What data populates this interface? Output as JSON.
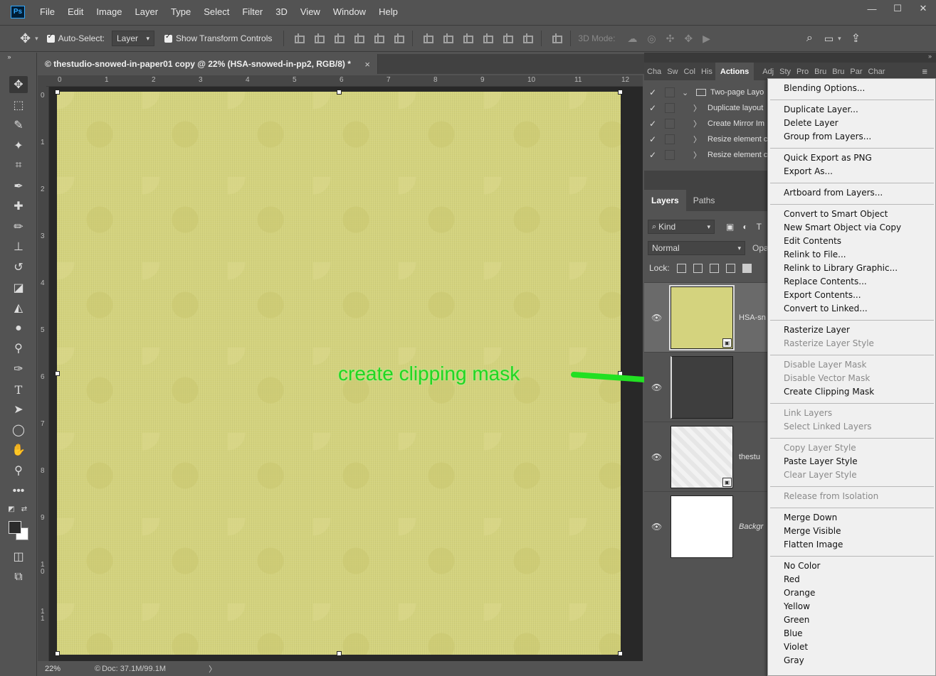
{
  "app": {
    "logo": "Ps"
  },
  "menubar": [
    "File",
    "Edit",
    "Image",
    "Layer",
    "Type",
    "Select",
    "Filter",
    "3D",
    "View",
    "Window",
    "Help"
  ],
  "window_controls": {
    "minimize": "—",
    "maximize": "☐",
    "close": "✕"
  },
  "options": {
    "auto_select_label": "Auto-Select:",
    "auto_select_checked": true,
    "auto_select_target": "Layer",
    "show_transform_label": "Show Transform Controls",
    "show_transform_checked": true,
    "mode_3d_label": "3D Mode:"
  },
  "document": {
    "tab_title": "© thestudio-snowed-in-paper01 copy @ 22% (HSA-snowed-in-pp2, RGB/8) *",
    "close": "×",
    "zoom": "22%",
    "doc_size": "Doc: 37.1M/99.1M",
    "status_chevron": "〉"
  },
  "rulers": {
    "h_ticks": [
      "0",
      "1",
      "2",
      "3",
      "4",
      "5",
      "6",
      "7",
      "8",
      "9",
      "10",
      "11",
      "12"
    ],
    "v_ticks": [
      "0",
      "1",
      "2",
      "3",
      "4",
      "5",
      "6",
      "7",
      "8",
      "9",
      "1\n0",
      "1\n1"
    ]
  },
  "canvas": {
    "fill_color": "#d4d37e"
  },
  "annotation": {
    "text": "create clipping mask",
    "color": "#22d622"
  },
  "top_panel_tabs": [
    "Cha",
    "Sw",
    "Col",
    "His",
    "Actions",
    "Adj",
    "Sty",
    "Pro",
    "Bru",
    "Bru",
    "Par",
    "Char"
  ],
  "top_panel_active": "Actions",
  "actions": [
    {
      "label": "Two-page Layo",
      "checked": true,
      "expanded": true,
      "folder": true
    },
    {
      "label": "Duplicate layout",
      "checked": true
    },
    {
      "label": "Create Mirror Im",
      "checked": true
    },
    {
      "label": "Resize element c",
      "checked": true
    },
    {
      "label": "Resize element c",
      "checked": true
    }
  ],
  "layers_tabs": [
    "Layers",
    "Paths"
  ],
  "layers_filter": {
    "kind_label": "Kind",
    "blend_mode": "Normal",
    "opacity_label": "Opa",
    "lock_label": "Lock:"
  },
  "layers": [
    {
      "name": "HSA-sn",
      "selected": true,
      "thumb": "yellow",
      "smart": true
    },
    {
      "name": "",
      "selected": false,
      "thumb": "dark",
      "smart": false
    },
    {
      "name": "thestu",
      "selected": false,
      "thumb": "white-pattern",
      "smart": true
    },
    {
      "name": "Backgr",
      "selected": false,
      "thumb": "white",
      "smart": false
    }
  ],
  "context_menu": [
    {
      "label": "Blending Options...",
      "disabled": false
    },
    {
      "sep": true
    },
    {
      "label": "Duplicate Layer...",
      "disabled": false
    },
    {
      "label": "Delete Layer",
      "disabled": false
    },
    {
      "label": "Group from Layers...",
      "disabled": false
    },
    {
      "sep": true
    },
    {
      "label": "Quick Export as PNG",
      "disabled": false
    },
    {
      "label": "Export As...",
      "disabled": false
    },
    {
      "sep": true
    },
    {
      "label": "Artboard from Layers...",
      "disabled": false
    },
    {
      "sep": true
    },
    {
      "label": "Convert to Smart Object",
      "disabled": false
    },
    {
      "label": "New Smart Object via Copy",
      "disabled": false
    },
    {
      "label": "Edit Contents",
      "disabled": false
    },
    {
      "label": "Relink to File...",
      "disabled": false
    },
    {
      "label": "Relink to Library Graphic...",
      "disabled": false
    },
    {
      "label": "Replace Contents...",
      "disabled": false
    },
    {
      "label": "Export Contents...",
      "disabled": false
    },
    {
      "label": "Convert to Linked...",
      "disabled": false
    },
    {
      "sep": true
    },
    {
      "label": "Rasterize Layer",
      "disabled": false
    },
    {
      "label": "Rasterize Layer Style",
      "disabled": true
    },
    {
      "sep": true
    },
    {
      "label": "Disable Layer Mask",
      "disabled": true
    },
    {
      "label": "Disable Vector Mask",
      "disabled": true
    },
    {
      "label": "Create Clipping Mask",
      "disabled": false
    },
    {
      "sep": true
    },
    {
      "label": "Link Layers",
      "disabled": true
    },
    {
      "label": "Select Linked Layers",
      "disabled": true
    },
    {
      "sep": true
    },
    {
      "label": "Copy Layer Style",
      "disabled": true
    },
    {
      "label": "Paste Layer Style",
      "disabled": false
    },
    {
      "label": "Clear Layer Style",
      "disabled": true
    },
    {
      "sep": true
    },
    {
      "label": "Release from Isolation",
      "disabled": true
    },
    {
      "sep": true
    },
    {
      "label": "Merge Down",
      "disabled": false
    },
    {
      "label": "Merge Visible",
      "disabled": false
    },
    {
      "label": "Flatten Image",
      "disabled": false
    },
    {
      "sep": true
    },
    {
      "label": "No Color",
      "disabled": false
    },
    {
      "label": "Red",
      "disabled": false
    },
    {
      "label": "Orange",
      "disabled": false
    },
    {
      "label": "Yellow",
      "disabled": false
    },
    {
      "label": "Green",
      "disabled": false
    },
    {
      "label": "Blue",
      "disabled": false
    },
    {
      "label": "Violet",
      "disabled": false
    },
    {
      "label": "Gray",
      "disabled": false
    }
  ]
}
